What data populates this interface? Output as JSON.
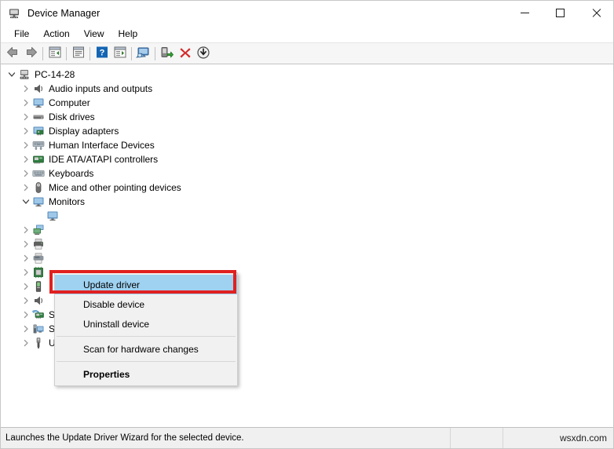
{
  "window": {
    "title": "Device Manager",
    "icon": "device-manager-icon",
    "controls": {
      "minimize": "Minimize",
      "maximize": "Maximize",
      "close": "Close"
    }
  },
  "menubar": {
    "items": [
      {
        "label": "File",
        "name": "menu-file"
      },
      {
        "label": "Action",
        "name": "menu-action"
      },
      {
        "label": "View",
        "name": "menu-view"
      },
      {
        "label": "Help",
        "name": "menu-help"
      }
    ]
  },
  "toolbar": {
    "buttons": [
      {
        "name": "back-icon",
        "title": "Back"
      },
      {
        "name": "forward-icon",
        "title": "Forward"
      },
      {
        "name": "show-hide-console-tree-icon",
        "title": "Show/Hide Console Tree"
      },
      {
        "name": "properties-icon",
        "title": "Properties"
      },
      {
        "name": "help-icon",
        "title": "Help"
      },
      {
        "name": "show-hide-action-pane-icon",
        "title": "Show/Hide Action Pane"
      },
      {
        "name": "scan-for-hardware-changes-icon",
        "title": "Scan for hardware changes"
      },
      {
        "name": "update-driver-icon",
        "title": "Update Driver Software"
      },
      {
        "name": "uninstall-device-icon",
        "title": "Uninstall device"
      },
      {
        "name": "disable-device-icon",
        "title": "Disable device"
      }
    ]
  },
  "tree": {
    "root": {
      "label": "PC-14-28",
      "icon": "computer-root-icon",
      "expanded": true
    },
    "items": [
      {
        "label": "Audio inputs and outputs",
        "icon": "speaker-icon",
        "expanded": false
      },
      {
        "label": "Computer",
        "icon": "monitor-icon",
        "expanded": false
      },
      {
        "label": "Disk drives",
        "icon": "disk-drive-icon",
        "expanded": false
      },
      {
        "label": "Display adapters",
        "icon": "display-adapter-icon",
        "expanded": false
      },
      {
        "label": "Human Interface Devices",
        "icon": "hid-icon",
        "expanded": false
      },
      {
        "label": "IDE ATA/ATAPI controllers",
        "icon": "ide-controller-icon",
        "expanded": false
      },
      {
        "label": "Keyboards",
        "icon": "keyboard-icon",
        "expanded": false
      },
      {
        "label": "Mice and other pointing devices",
        "icon": "mouse-icon",
        "expanded": false
      },
      {
        "label": "Monitors",
        "icon": "monitor-icon",
        "expanded": true
      },
      {
        "label": "",
        "icon": "monitor-child-icon",
        "expanded": null,
        "child": true
      },
      {
        "label": "",
        "icon": "network-adapter-icon",
        "expanded": false
      },
      {
        "label": "",
        "icon": "print-queue-icon",
        "expanded": false
      },
      {
        "label": "",
        "icon": "printer-icon",
        "expanded": false
      },
      {
        "label": "",
        "icon": "processor-icon",
        "expanded": false
      },
      {
        "label": "",
        "icon": "software-device-icon",
        "expanded": false
      },
      {
        "label": "",
        "icon": "sound-controller-icon",
        "expanded": false
      },
      {
        "label": "Storage controllers",
        "icon": "storage-controller-icon",
        "expanded": false
      },
      {
        "label": "System devices",
        "icon": "system-device-icon",
        "expanded": false
      },
      {
        "label": "Universal Serial Bus controllers",
        "icon": "usb-controller-icon",
        "expanded": false
      }
    ]
  },
  "context_menu": {
    "items": [
      {
        "label": "Update driver",
        "selected": true,
        "bold": false
      },
      {
        "label": "Disable device",
        "selected": false,
        "bold": false
      },
      {
        "label": "Uninstall device",
        "selected": false,
        "bold": false
      },
      {
        "separator": true
      },
      {
        "label": "Scan for hardware changes",
        "selected": false,
        "bold": false
      },
      {
        "separator": true
      },
      {
        "label": "Properties",
        "selected": false,
        "bold": true
      }
    ],
    "highlight_color": "#e02020",
    "selected_color": "#9fd1f0"
  },
  "statusbar": {
    "text": "Launches the Update Driver Wizard for the selected device.",
    "middle": "",
    "right": "wsxdn.com"
  }
}
